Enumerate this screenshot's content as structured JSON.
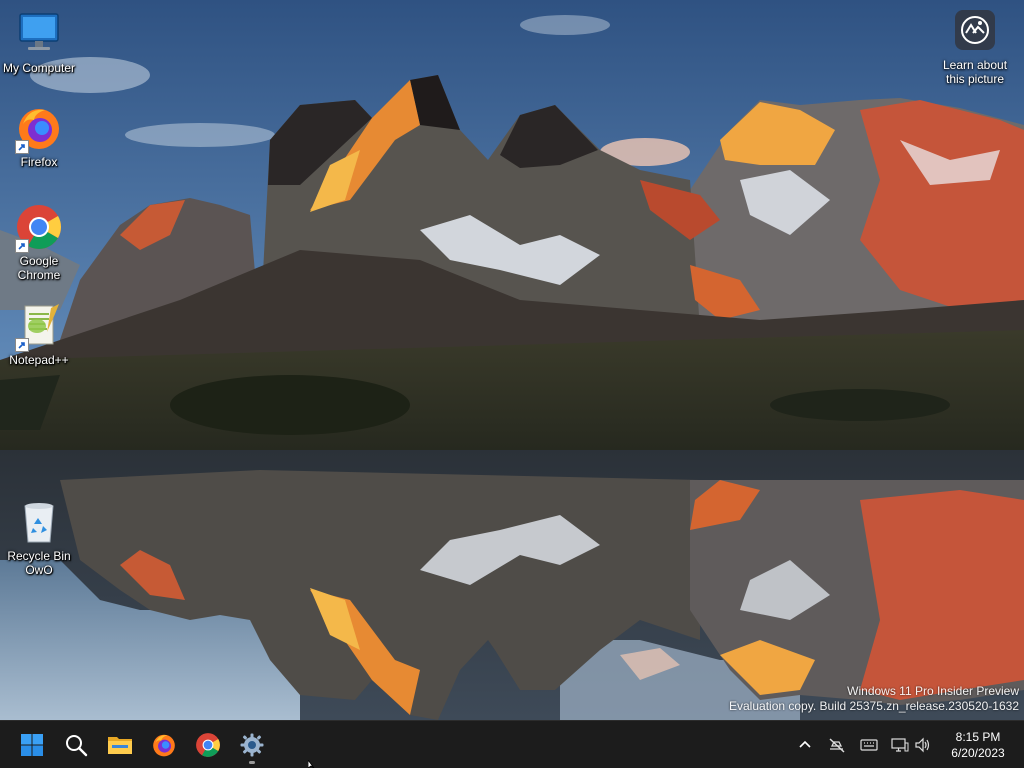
{
  "desktop": {
    "icons": [
      {
        "label": "My Computer",
        "icon": "monitor-icon"
      },
      {
        "label": "Firefox",
        "icon": "firefox-icon"
      },
      {
        "label": "Google\nChrome",
        "icon": "chrome-icon"
      },
      {
        "label": "Notepad++",
        "icon": "notepadpp-icon"
      },
      {
        "label": "Recycle Bin\nOwO",
        "icon": "recycle-bin-icon"
      }
    ],
    "learn_about_picture": "Learn about\nthis picture"
  },
  "watermark": {
    "line1": "Windows 11 Pro Insider Preview",
    "line2": "Evaluation copy. Build 25375.zn_release.230520-1632"
  },
  "taskbar": {
    "apps": [
      {
        "name": "start-button",
        "icon": "windows-icon"
      },
      {
        "name": "search-button",
        "icon": "search-icon"
      },
      {
        "name": "file-explorer",
        "icon": "folder-icon"
      },
      {
        "name": "firefox",
        "icon": "firefox-icon"
      },
      {
        "name": "chrome",
        "icon": "chrome-icon"
      },
      {
        "name": "settings",
        "icon": "gear-icon",
        "running": true
      }
    ],
    "tray": {
      "icons": [
        "chevron-up-icon",
        "network-offline-icon",
        "keyboard-icon",
        "display-icon",
        "volume-icon"
      ]
    },
    "clock": {
      "time": "8:15 PM",
      "date": "6/20/2023"
    }
  },
  "colors": {
    "taskbar_bg": "#1c1c1c",
    "sky_top": "#3a5e8c",
    "alpenglow": "#e06a2a"
  }
}
